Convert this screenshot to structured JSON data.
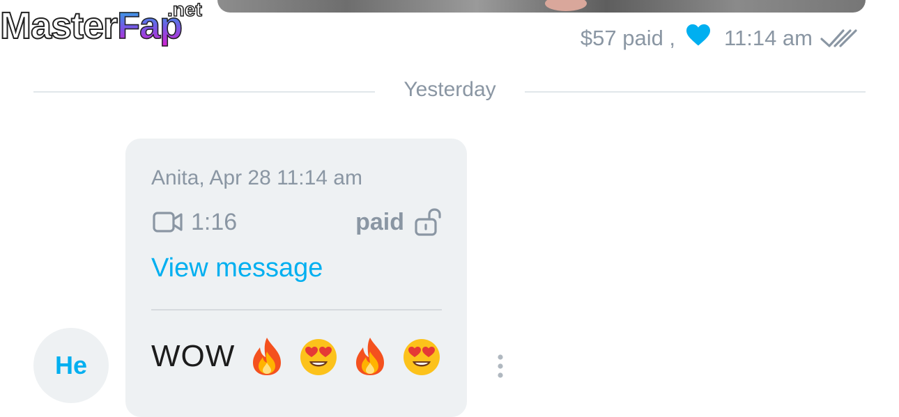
{
  "watermark": {
    "name": "MasterFap",
    "part1": "Master",
    "part2": "Fap",
    "tld": ".net"
  },
  "outgoing_message": {
    "price_paid": "$57 paid ,",
    "time": "11:14 am",
    "heart_color": "#00aff0",
    "status_icon": "double-check-icon"
  },
  "date_divider": {
    "label": "Yesterday"
  },
  "incoming_message": {
    "sender_line": "Anita, Apr 28 11:14 am",
    "video_duration": "1:16",
    "paid_label": "paid",
    "view_link": "View message",
    "text": "WOW",
    "emojis": [
      "fire",
      "heart-eyes",
      "fire",
      "heart-eyes"
    ]
  },
  "avatar": {
    "initials": "He"
  },
  "colors": {
    "accent": "#00aff0",
    "muted": "#8a96a3",
    "bubble": "#eef1f3"
  }
}
